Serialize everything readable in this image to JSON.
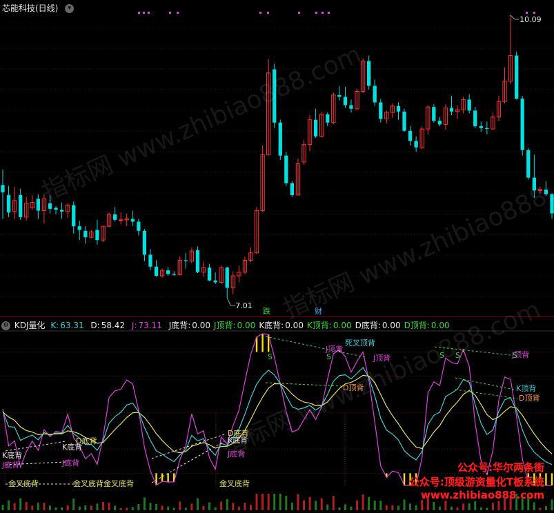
{
  "price_panel": {
    "title": "芯能科技(日线)",
    "high_label": "10.09",
    "low_label": "7.01",
    "marker_down": "跌",
    "marker_cai": "财"
  },
  "kdj_panel": {
    "name": "KDJ量化",
    "k_label": "K:",
    "k_value": "63.31",
    "d_label": "D:",
    "d_value": "58.42",
    "j_label": "J:",
    "j_value": "73.11",
    "stats": [
      {
        "label": "J底背:",
        "value": "0.00",
        "color": "#e8e8e8"
      },
      {
        "label": "J顶背:",
        "value": "0.00",
        "color": "#33dd33"
      },
      {
        "label": "K底背:",
        "value": "0.00",
        "color": "#e8e8e8"
      },
      {
        "label": "K顶背:",
        "value": "0.00",
        "color": "#33dd33"
      },
      {
        "label": "D底背:",
        "value": "0.00",
        "color": "#e8e8e8"
      },
      {
        "label": "D顶背:",
        "value": "0.00",
        "color": "#33dd33"
      }
    ],
    "annotations": {
      "k_bottom_div": "K底背",
      "j_bottom_div": "J底背",
      "d_bottom_div": "D底背",
      "j_top_div": "J顶背",
      "k_top_div": "K顶背",
      "d_top_div": "D顶背",
      "golden_cross_div": "金叉底背",
      "death_cross_div": "死叉顶背",
      "sell_mark": "S"
    }
  },
  "watermark": {
    "text1": "指标网 www.zhibiao888.com"
  },
  "promo": {
    "line1": "公众号:华尔两条街",
    "line2": "公众号:顶级游资量化T板系统",
    "line3": "www.zhibiao888.com"
  },
  "colors": {
    "up": "#ff3232",
    "down": "#00e0e0",
    "k": "#3ecfd6",
    "d": "#e8e060",
    "j": "#e040e0",
    "grid": "#8b1a1a",
    "divider": "#8b0000"
  },
  "chart_data": {
    "type": "candlestick",
    "price_range": [
      7.01,
      10.09
    ],
    "kdj_range": [
      -10,
      115
    ],
    "kdj_ref_lines": [
      0,
      20,
      50,
      80,
      100
    ],
    "candles": [
      {
        "o": 8.24,
        "h": 8.41,
        "l": 7.87,
        "c": 8.16
      },
      {
        "o": 8.13,
        "h": 8.23,
        "l": 7.89,
        "c": 7.94
      },
      {
        "o": 7.95,
        "h": 8.22,
        "l": 7.87,
        "c": 8.07
      },
      {
        "o": 8.13,
        "h": 8.2,
        "l": 7.86,
        "c": 7.89
      },
      {
        "o": 7.89,
        "h": 8.11,
        "l": 7.85,
        "c": 8.04
      },
      {
        "o": 7.99,
        "h": 8.13,
        "l": 7.97,
        "c": 8.05
      },
      {
        "o": 8.09,
        "h": 8.14,
        "l": 7.87,
        "c": 7.96
      },
      {
        "o": 7.96,
        "h": 8.14,
        "l": 7.82,
        "c": 8.09
      },
      {
        "o": 8.04,
        "h": 8.13,
        "l": 7.93,
        "c": 7.98
      },
      {
        "o": 7.99,
        "h": 8.01,
        "l": 7.92,
        "c": 7.97
      },
      {
        "o": 7.97,
        "h": 8.05,
        "l": 7.87,
        "c": 7.95
      },
      {
        "o": 7.95,
        "h": 8.04,
        "l": 7.88,
        "c": 8.02
      },
      {
        "o": 8.02,
        "h": 8.06,
        "l": 7.71,
        "c": 7.79
      },
      {
        "o": 7.79,
        "h": 7.85,
        "l": 7.64,
        "c": 7.75
      },
      {
        "o": 7.74,
        "h": 7.79,
        "l": 7.6,
        "c": 7.67
      },
      {
        "o": 7.67,
        "h": 7.75,
        "l": 7.66,
        "c": 7.73
      },
      {
        "o": 7.75,
        "h": 7.86,
        "l": 7.59,
        "c": 7.64
      },
      {
        "o": 7.64,
        "h": 7.79,
        "l": 7.62,
        "c": 7.79
      },
      {
        "o": 7.79,
        "h": 7.94,
        "l": 7.78,
        "c": 7.92
      },
      {
        "o": 7.92,
        "h": 8.0,
        "l": 7.84,
        "c": 7.86
      },
      {
        "o": 7.86,
        "h": 7.94,
        "l": 7.81,
        "c": 7.86
      },
      {
        "o": 7.86,
        "h": 7.93,
        "l": 7.79,
        "c": 7.87
      },
      {
        "o": 7.87,
        "h": 7.96,
        "l": 7.79,
        "c": 7.84
      },
      {
        "o": 7.84,
        "h": 7.87,
        "l": 7.69,
        "c": 7.74
      },
      {
        "o": 7.74,
        "h": 7.76,
        "l": 7.41,
        "c": 7.48
      },
      {
        "o": 7.48,
        "h": 7.54,
        "l": 7.31,
        "c": 7.35
      },
      {
        "o": 7.35,
        "h": 7.42,
        "l": 7.24,
        "c": 7.25
      },
      {
        "o": 7.25,
        "h": 7.33,
        "l": 7.23,
        "c": 7.31
      },
      {
        "o": 7.31,
        "h": 7.35,
        "l": 7.25,
        "c": 7.27
      },
      {
        "o": 7.27,
        "h": 7.3,
        "l": 7.25,
        "c": 7.26
      },
      {
        "o": 7.26,
        "h": 7.46,
        "l": 7.26,
        "c": 7.42
      },
      {
        "o": 7.42,
        "h": 7.5,
        "l": 7.33,
        "c": 7.41
      },
      {
        "o": 7.41,
        "h": 7.56,
        "l": 7.39,
        "c": 7.52
      },
      {
        "o": 7.53,
        "h": 7.57,
        "l": 7.28,
        "c": 7.29
      },
      {
        "o": 7.29,
        "h": 7.41,
        "l": 7.24,
        "c": 7.34
      },
      {
        "o": 7.34,
        "h": 7.38,
        "l": 7.19,
        "c": 7.2
      },
      {
        "o": 7.2,
        "h": 7.29,
        "l": 7.16,
        "c": 7.18
      },
      {
        "o": 7.18,
        "h": 7.36,
        "l": 7.16,
        "c": 7.34
      },
      {
        "o": 7.34,
        "h": 7.35,
        "l": 7.01,
        "c": 7.12
      },
      {
        "o": 7.12,
        "h": 7.3,
        "l": 7.05,
        "c": 7.25
      },
      {
        "o": 7.25,
        "h": 7.36,
        "l": 7.18,
        "c": 7.29
      },
      {
        "o": 7.29,
        "h": 7.46,
        "l": 7.27,
        "c": 7.42
      },
      {
        "o": 7.42,
        "h": 7.56,
        "l": 7.4,
        "c": 7.5
      },
      {
        "o": 7.5,
        "h": 8.0,
        "l": 7.49,
        "c": 7.96
      },
      {
        "o": 7.96,
        "h": 8.67,
        "l": 7.95,
        "c": 8.57
      },
      {
        "o": 8.57,
        "h": 9.61,
        "l": 8.56,
        "c": 9.46
      },
      {
        "o": 9.5,
        "h": 9.56,
        "l": 8.86,
        "c": 8.92
      },
      {
        "o": 8.92,
        "h": 8.95,
        "l": 8.51,
        "c": 8.56
      },
      {
        "o": 8.56,
        "h": 8.6,
        "l": 8.23,
        "c": 8.26
      },
      {
        "o": 8.26,
        "h": 8.28,
        "l": 8.11,
        "c": 8.13
      },
      {
        "o": 8.13,
        "h": 8.53,
        "l": 8.13,
        "c": 8.47
      },
      {
        "o": 8.49,
        "h": 8.73,
        "l": 8.46,
        "c": 8.68
      },
      {
        "o": 8.68,
        "h": 9.0,
        "l": 8.61,
        "c": 8.95
      },
      {
        "o": 8.95,
        "h": 9.07,
        "l": 8.75,
        "c": 8.77
      },
      {
        "o": 8.77,
        "h": 9.03,
        "l": 8.76,
        "c": 9.01
      },
      {
        "o": 9.01,
        "h": 9.03,
        "l": 8.88,
        "c": 8.92
      },
      {
        "o": 8.92,
        "h": 9.25,
        "l": 8.9,
        "c": 9.22
      },
      {
        "o": 9.22,
        "h": 9.32,
        "l": 9.16,
        "c": 9.2
      },
      {
        "o": 9.2,
        "h": 9.31,
        "l": 9.08,
        "c": 9.11
      },
      {
        "o": 9.11,
        "h": 9.17,
        "l": 9.03,
        "c": 9.07
      },
      {
        "o": 9.07,
        "h": 9.29,
        "l": 9.05,
        "c": 9.26
      },
      {
        "o": 9.26,
        "h": 9.62,
        "l": 9.24,
        "c": 9.59
      },
      {
        "o": 9.59,
        "h": 9.65,
        "l": 9.28,
        "c": 9.32
      },
      {
        "o": 9.32,
        "h": 9.39,
        "l": 9.1,
        "c": 9.14
      },
      {
        "o": 9.14,
        "h": 9.18,
        "l": 8.92,
        "c": 8.96
      },
      {
        "o": 8.96,
        "h": 9.05,
        "l": 8.91,
        "c": 9.03
      },
      {
        "o": 9.03,
        "h": 9.13,
        "l": 8.97,
        "c": 9.1
      },
      {
        "o": 9.1,
        "h": 9.14,
        "l": 8.95,
        "c": 9.04
      },
      {
        "o": 9.04,
        "h": 9.07,
        "l": 8.82,
        "c": 8.83
      },
      {
        "o": 8.83,
        "h": 8.88,
        "l": 8.67,
        "c": 8.72
      },
      {
        "o": 8.72,
        "h": 8.77,
        "l": 8.6,
        "c": 8.65
      },
      {
        "o": 8.65,
        "h": 8.88,
        "l": 8.63,
        "c": 8.85
      },
      {
        "o": 8.85,
        "h": 9.11,
        "l": 8.79,
        "c": 9.09
      },
      {
        "o": 9.09,
        "h": 9.12,
        "l": 8.92,
        "c": 8.94
      },
      {
        "o": 8.94,
        "h": 8.98,
        "l": 8.88,
        "c": 8.9
      },
      {
        "o": 8.9,
        "h": 9.12,
        "l": 8.84,
        "c": 9.08
      },
      {
        "o": 9.08,
        "h": 9.21,
        "l": 9.0,
        "c": 9.04
      },
      {
        "o": 9.04,
        "h": 9.11,
        "l": 8.96,
        "c": 9.06
      },
      {
        "o": 9.06,
        "h": 9.2,
        "l": 9.02,
        "c": 9.17
      },
      {
        "o": 9.17,
        "h": 9.23,
        "l": 9.02,
        "c": 9.05
      },
      {
        "o": 9.05,
        "h": 9.09,
        "l": 8.86,
        "c": 8.88
      },
      {
        "o": 8.88,
        "h": 8.93,
        "l": 8.82,
        "c": 8.86
      },
      {
        "o": 8.86,
        "h": 8.93,
        "l": 8.79,
        "c": 8.85
      },
      {
        "o": 8.85,
        "h": 9.03,
        "l": 8.85,
        "c": 8.98
      },
      {
        "o": 8.98,
        "h": 9.21,
        "l": 8.94,
        "c": 9.15
      },
      {
        "o": 9.15,
        "h": 9.52,
        "l": 9.13,
        "c": 9.37
      },
      {
        "o": 9.37,
        "h": 10.09,
        "l": 9.34,
        "c": 9.65
      },
      {
        "o": 9.65,
        "h": 9.69,
        "l": 9.17,
        "c": 9.18
      },
      {
        "o": 9.18,
        "h": 9.21,
        "l": 8.56,
        "c": 8.62
      },
      {
        "o": 8.62,
        "h": 8.64,
        "l": 8.3,
        "c": 8.32
      },
      {
        "o": 8.32,
        "h": 8.57,
        "l": 8.1,
        "c": 8.18
      },
      {
        "o": 8.18,
        "h": 8.22,
        "l": 8.15,
        "c": 8.19
      },
      {
        "o": 8.19,
        "h": 8.28,
        "l": 8.12,
        "c": 8.14
      },
      {
        "o": 8.14,
        "h": 8.15,
        "l": 7.87,
        "c": 7.93
      }
    ]
  }
}
